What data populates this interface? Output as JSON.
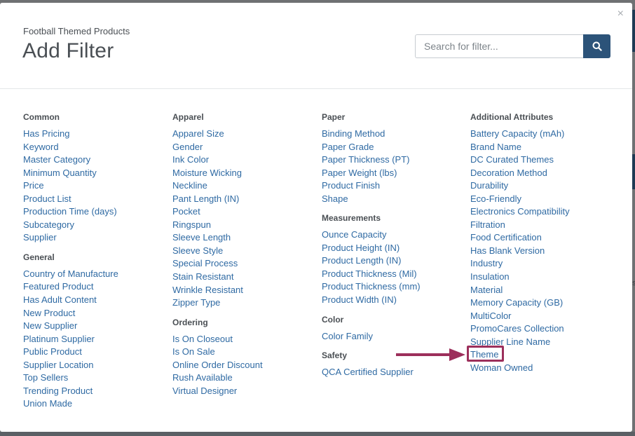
{
  "modal": {
    "subtitle": "Football Themed Products",
    "title": "Add Filter",
    "close_glyph": "×",
    "search": {
      "placeholder": "Search for filter...",
      "value": "",
      "button_icon": "search-icon"
    }
  },
  "columns": [
    {
      "groups": [
        {
          "title": "Common",
          "items": [
            "Has Pricing",
            "Keyword",
            "Master Category",
            "Minimum Quantity",
            "Price",
            "Product List",
            "Production Time (days)",
            "Subcategory",
            "Supplier"
          ]
        },
        {
          "title": "General",
          "items": [
            "Country of Manufacture",
            "Featured Product",
            "Has Adult Content",
            "New Product",
            "New Supplier",
            "Platinum Supplier",
            "Public Product",
            "Supplier Location",
            "Top Sellers",
            "Trending Product",
            "Union Made"
          ]
        }
      ]
    },
    {
      "groups": [
        {
          "title": "Apparel",
          "items": [
            "Apparel Size",
            "Gender",
            "Ink Color",
            "Moisture Wicking",
            "Neckline",
            "Pant Length (IN)",
            "Pocket",
            "Ringspun",
            "Sleeve Length",
            "Sleeve Style",
            "Special Process",
            "Stain Resistant",
            "Wrinkle Resistant",
            "Zipper Type"
          ]
        },
        {
          "title": "Ordering",
          "items": [
            "Is On Closeout",
            "Is On Sale",
            "Online Order Discount",
            "Rush Available",
            "Virtual Designer"
          ]
        }
      ]
    },
    {
      "groups": [
        {
          "title": "Paper",
          "items": [
            "Binding Method",
            "Paper Grade",
            "Paper Thickness (PT)",
            "Paper Weight (lbs)",
            "Product Finish",
            "Shape"
          ]
        },
        {
          "title": "Measurements",
          "items": [
            "Ounce Capacity",
            "Product Height (IN)",
            "Product Length (IN)",
            "Product Thickness (Mil)",
            "Product Thickness (mm)",
            "Product Width (IN)"
          ]
        },
        {
          "title": "Color",
          "items": [
            "Color Family"
          ]
        },
        {
          "title": "Safety",
          "items": [
            "QCA Certified Supplier"
          ]
        }
      ]
    },
    {
      "groups": [
        {
          "title": "Additional Attributes",
          "items": [
            "Battery Capacity (mAh)",
            "Brand Name",
            "DC Curated Themes",
            "Decoration Method",
            "Durability",
            "Eco-Friendly",
            "Electronics Compatibility",
            "Filtration",
            "Food Certification",
            "Has Blank Version",
            "Industry",
            "Insulation",
            "Material",
            "Memory Capacity (GB)",
            "MultiColor",
            "PromoCares Collection",
            "Supplier Line Name",
            "Theme",
            "Woman Owned"
          ]
        }
      ]
    }
  ],
  "annotation": {
    "highlighted_item": "Theme",
    "arrow_color": "#9c2f5b"
  },
  "colors": {
    "link": "#2f6aa3",
    "heading": "#4a4f54",
    "search_button": "#2c5379",
    "accent": "#9c2f5b"
  }
}
